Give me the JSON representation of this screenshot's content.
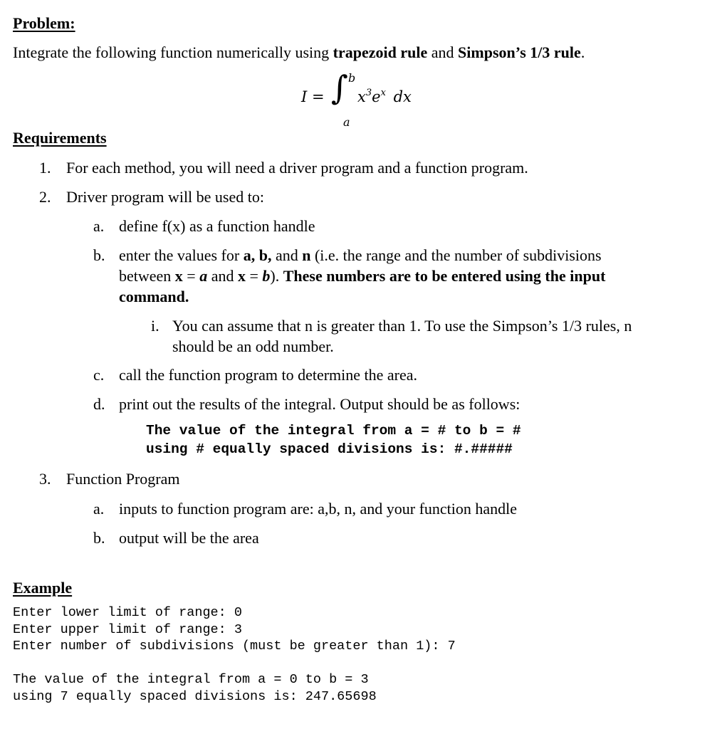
{
  "problem": {
    "heading": "Problem:",
    "intro_prefix": "Integrate the following function numerically using ",
    "intro_bold1": "trapezoid rule",
    "intro_mid": " and ",
    "intro_bold2": "Simpson’s 1/3 rule",
    "intro_suffix": "."
  },
  "equation": {
    "lhs": "I =",
    "integral_sign": "∫",
    "upper_limit": "b",
    "lower_limit": "a",
    "base1": "x",
    "exp1": "3",
    "base2": "e",
    "exp2": "x",
    "differential": "dx"
  },
  "requirements": {
    "heading": "Requirements",
    "items": [
      {
        "marker": "1.",
        "text": "For each method, you will need a driver program and a function program."
      },
      {
        "marker": "2.",
        "text": "Driver program will be used to:"
      }
    ],
    "driver": {
      "a": {
        "marker": "a.",
        "text": "define f(x) as a function handle"
      },
      "b": {
        "marker": "b.",
        "t1": "enter the values  for ",
        "b1": "a, b,",
        "t2": " and ",
        "b2": "n",
        "t3": " (i.e. the range and the number of subdivisions",
        "line2_t1": "between ",
        "line2_x1": "x",
        "line2_eq1": " = ",
        "line2_a": "a",
        "line2_and": " and  ",
        "line2_x2": "x",
        "line2_eq2": " = ",
        "line2_b": "b",
        "line2_close": ").  ",
        "line2_bold": "These numbers are to be entered using the input",
        "line3_bold": "command."
      },
      "b_sub": {
        "marker": "i.",
        "line1": "You can assume that n is greater than 1. To use the Simpson’s 1/3 rules, n",
        "line2": "should be an odd number."
      },
      "c": {
        "marker": "c.",
        "text": "call the function program to determine the area."
      },
      "d": {
        "marker": "d.",
        "text": "print out the results of the integral.  Output should be as follows:"
      },
      "output_format": [
        "The value of the integral from a = # to b = #",
        "using # equally spaced divisions is: #.#####"
      ]
    },
    "function_program": {
      "marker": "3.",
      "text": "Function Program",
      "a": {
        "marker": "a.",
        "text": "inputs to function program are: a,b, n, and your function handle"
      },
      "b": {
        "marker": "b.",
        "text": "output will be the area"
      }
    }
  },
  "example": {
    "heading": "Example",
    "prompts": [
      "Enter lower limit of range: 0",
      "Enter upper limit of range: 3",
      "Enter number of subdivisions (must be greater than 1): 7"
    ],
    "result": [
      "The value of the integral from a = 0 to b = 3",
      "using 7 equally spaced divisions is: 247.65698"
    ]
  }
}
